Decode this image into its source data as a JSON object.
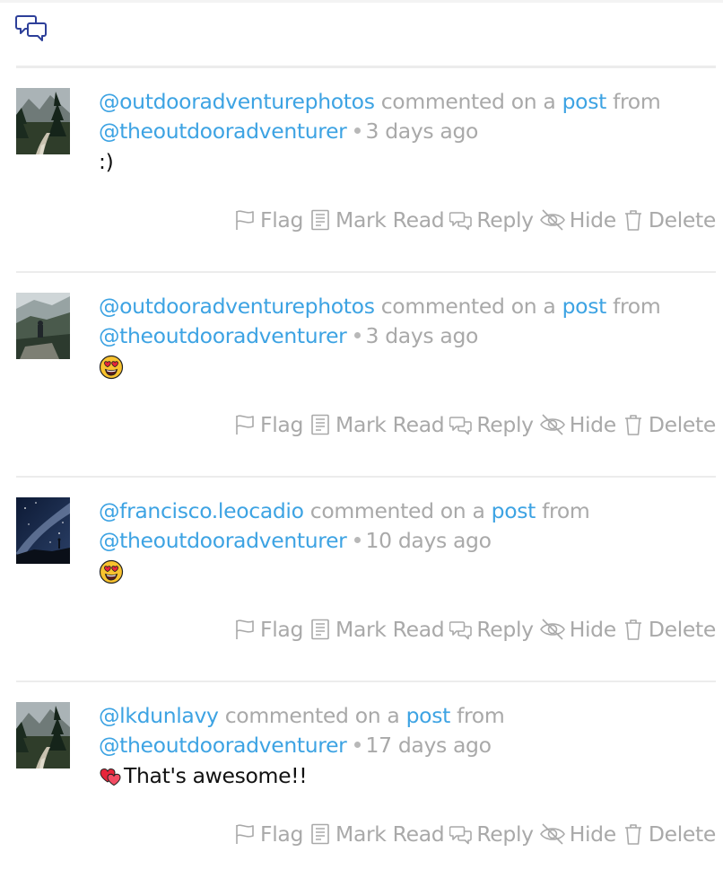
{
  "header": {
    "icon": "comments-icon"
  },
  "labels": {
    "commented_on_a": "commented on a",
    "post": "post",
    "from": "from"
  },
  "colors": {
    "link": "#3da3e3",
    "muted": "#a9a9a9",
    "header_icon": "#2d3f99"
  },
  "notifications": [
    {
      "user": "@outdooradventurephotos",
      "page": "@theoutdooradventurer",
      "time": "3 days ago",
      "comment": ":)",
      "emoji": "",
      "avatar": "forest-trail-photo"
    },
    {
      "user": "@outdooradventurephotos",
      "page": "@theoutdooradventurer",
      "time": "3 days ago",
      "comment": "",
      "emoji": "heart-eyes-emoji",
      "avatar": "misty-mountain-hiker-photo"
    },
    {
      "user": "@francisco.leocadio",
      "page": "@theoutdooradventurer",
      "time": "10 days ago",
      "comment": "",
      "emoji": "heart-eyes-emoji",
      "avatar": "milky-way-night-photo"
    },
    {
      "user": "@lkdunlavy",
      "page": "@theoutdooradventurer",
      "time": "17 days ago",
      "comment": "That's awesome!!",
      "emoji": "two-hearts-emoji",
      "avatar": "forest-trail-photo"
    }
  ],
  "actions": {
    "flag": "Flag",
    "mark_read": "Mark Read",
    "reply": "Reply",
    "hide": "Hide",
    "delete": "Delete"
  }
}
